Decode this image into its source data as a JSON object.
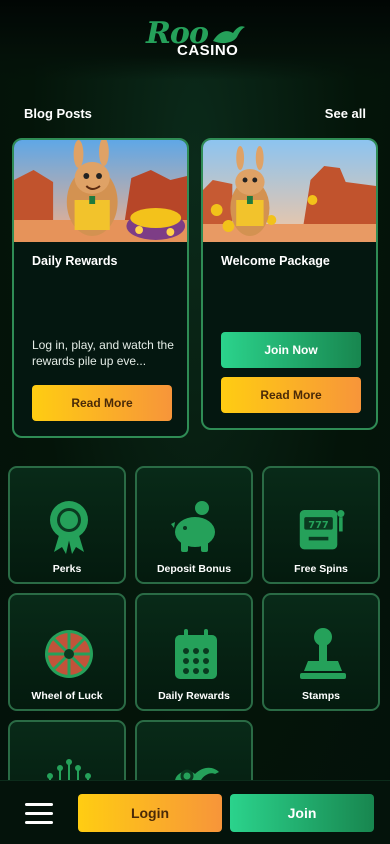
{
  "brand": {
    "name_top": "Roo",
    "name_bottom": "CASINO"
  },
  "blog": {
    "title": "Blog Posts",
    "see_all": "See all",
    "cards": [
      {
        "title": "Daily Rewards",
        "description": "Log in, play, and watch the rewards pile up eve...",
        "read_more": "Read More"
      },
      {
        "title": "Welcome Package",
        "join_now": "Join Now",
        "read_more": "Read More"
      }
    ]
  },
  "tiles": [
    {
      "label": "Perks",
      "icon": "medal-icon"
    },
    {
      "label": "Deposit Bonus",
      "icon": "piggy-bank-icon"
    },
    {
      "label": "Free Spins",
      "icon": "slot-machine-icon"
    },
    {
      "label": "Wheel of Luck",
      "icon": "wheel-icon"
    },
    {
      "label": "Daily Rewards",
      "icon": "calendar-icon"
    },
    {
      "label": "Stamps",
      "icon": "stamp-icon"
    },
    {
      "label": "",
      "icon": "crown-icon"
    },
    {
      "label": "",
      "icon": "genie-lamp-icon"
    }
  ],
  "bottom_bar": {
    "login": "Login",
    "join": "Join"
  },
  "colors": {
    "accent_green": "#2bd38c",
    "accent_orange": "#ffcd12",
    "border_green": "#2f8c55"
  }
}
